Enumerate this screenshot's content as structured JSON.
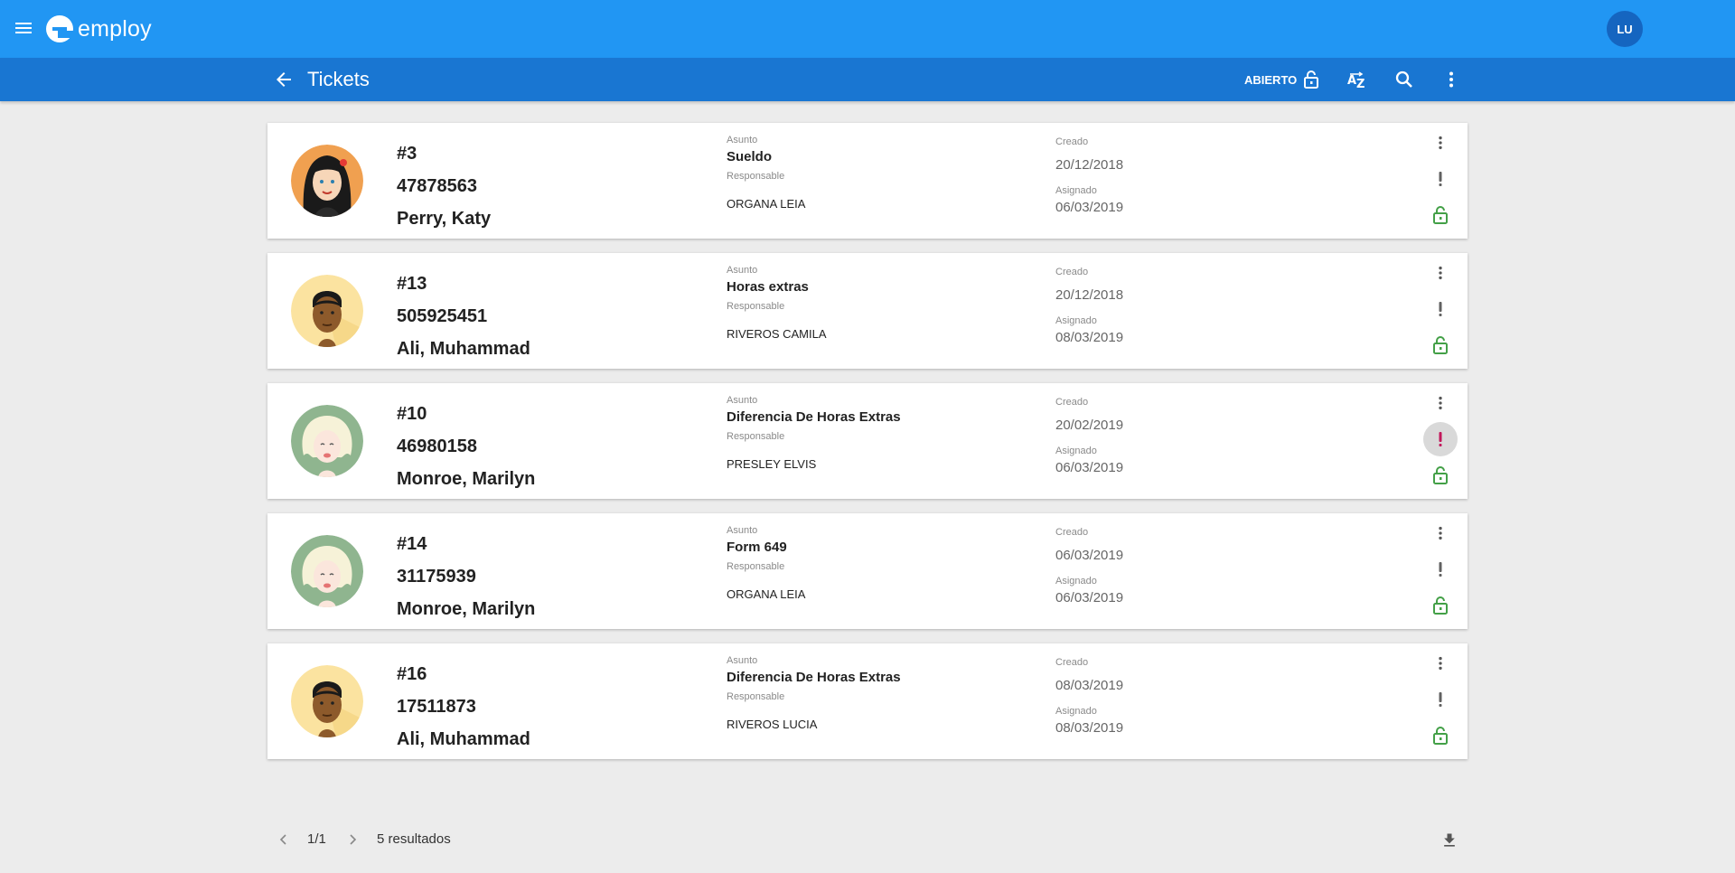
{
  "app": {
    "logo_text": "employ",
    "user_initials": "LU"
  },
  "toolbar": {
    "title": "Tickets",
    "filter_label": "ABIERTO"
  },
  "labels": {
    "subject": "Asunto",
    "responsible": "Responsable",
    "created": "Creado",
    "assigned": "Asignado"
  },
  "tickets": [
    {
      "number": "#3",
      "doc": "47878563",
      "name": "Perry, Katy",
      "subject": "Sueldo",
      "responsible": "ORGANA LEIA",
      "created": "20/12/2018",
      "assigned": "06/03/2019",
      "avatar": "woman-dark-hair",
      "priority_highlight": false
    },
    {
      "number": "#13",
      "doc": "505925451",
      "name": "Ali, Muhammad",
      "subject": "Horas extras",
      "responsible": "RIVEROS CAMILA",
      "created": "20/12/2018",
      "assigned": "08/03/2019",
      "avatar": "man-dark-skin",
      "priority_highlight": false
    },
    {
      "number": "#10",
      "doc": "46980158",
      "name": "Monroe, Marilyn",
      "subject": "Diferencia De Horas Extras",
      "responsible": "PRESLEY ELVIS",
      "created": "20/02/2019",
      "assigned": "06/03/2019",
      "avatar": "woman-blonde",
      "priority_highlight": true
    },
    {
      "number": "#14",
      "doc": "31175939",
      "name": "Monroe, Marilyn",
      "subject": "Form 649",
      "responsible": "ORGANA LEIA",
      "created": "06/03/2019",
      "assigned": "06/03/2019",
      "avatar": "woman-blonde",
      "priority_highlight": false
    },
    {
      "number": "#16",
      "doc": "17511873",
      "name": "Ali, Muhammad",
      "subject": "Diferencia De Horas Extras",
      "responsible": "RIVEROS LUCIA",
      "created": "08/03/2019",
      "assigned": "08/03/2019",
      "avatar": "man-dark-skin",
      "priority_highlight": false
    }
  ],
  "footer": {
    "page": "1/1",
    "results": "5 resultados"
  },
  "colors": {
    "appbar": "#2196f3",
    "toolbar": "#1976d2",
    "lock_green": "#43a047",
    "priority_red": "#c2185b",
    "priority_grey": "#616161"
  }
}
